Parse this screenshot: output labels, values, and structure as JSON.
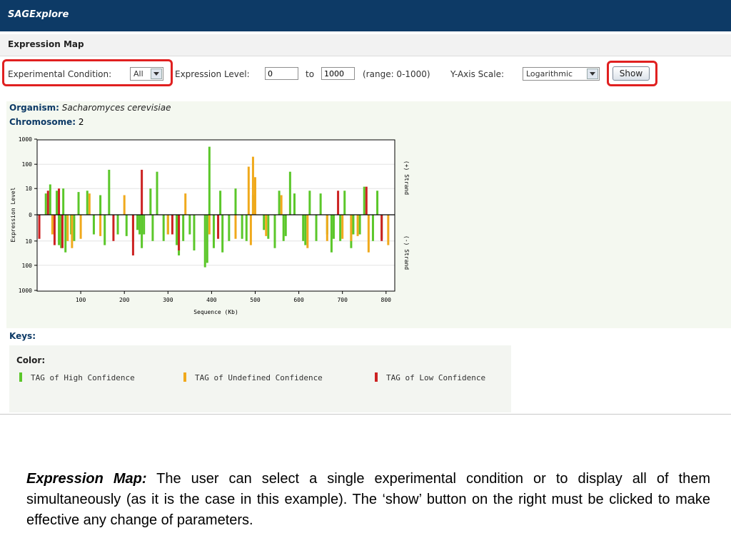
{
  "app": {
    "name": "SAGExplore"
  },
  "page": {
    "title": "Expression Map"
  },
  "controls": {
    "condition_label": "Experimental Condition:",
    "condition_value": "All",
    "level_label": "Expression Level:",
    "level_from": "0",
    "to_label": "to",
    "level_to": "1000",
    "range_hint": "(range: 0-1000)",
    "scale_label": "Y-Axis Scale:",
    "scale_value": "Logarithmic",
    "show_label": "Show"
  },
  "info": {
    "organism_label": "Organism:",
    "organism_value": "Sacharomyces cerevisiae",
    "chromosome_label": "Chromosome:",
    "chromosome_value": "2"
  },
  "keys": {
    "title": "Keys:",
    "color_title": "Color:",
    "items": [
      {
        "label": "TAG of High Confidence",
        "color": "#5bc72a"
      },
      {
        "label": "TAG of Undefined Confidence",
        "color": "#f0a91c"
      },
      {
        "label": "TAG of Low Confidence",
        "color": "#cc2222"
      }
    ]
  },
  "caption": {
    "lead": "Expression Map:",
    "text": "The user can select a single experimental condition or to display all of them simultaneously (as it is the case in this example). The ‘show’ button on the right must be clicked to make effective any change of parameters."
  },
  "chart_data": {
    "type": "bar",
    "xlabel": "Sequence (Kb)",
    "ylabel": "Expression Level",
    "upper_strand_label": "(+) Strand",
    "lower_strand_label": "(-) Strand",
    "x_ticks": [
      100,
      200,
      300,
      400,
      500,
      600,
      700,
      800
    ],
    "xlim": [
      0,
      820
    ],
    "y_ticks": [
      "1000",
      "100",
      "10",
      "0",
      "10",
      "100",
      "1000"
    ],
    "y_scale": "log",
    "ylim": [
      0,
      1000
    ],
    "colors": {
      "high": "#5bc72a",
      "undefined": "#f0a91c",
      "low": "#cc2222"
    },
    "series": [
      {
        "name": "TAG of High Confidence",
        "confidence": "high",
        "x": [
          20,
          30,
          45,
          50,
          55,
          60,
          65,
          78,
          85,
          95,
          115,
          130,
          145,
          155,
          165,
          185,
          205,
          230,
          235,
          240,
          245,
          260,
          265,
          275,
          290,
          300,
          320,
          325,
          335,
          350,
          360,
          385,
          390,
          395,
          405,
          420,
          425,
          440,
          455,
          470,
          480,
          495,
          520,
          530,
          545,
          555,
          565,
          570,
          580,
          590,
          610,
          615,
          625,
          640,
          650,
          665,
          675,
          680,
          695,
          705,
          720,
          725,
          740,
          750,
          770,
          780,
          790
        ],
        "y": [
          6,
          15,
          8,
          -15,
          -20,
          10,
          -30,
          -5,
          -10,
          7,
          8,
          -5,
          5,
          -15,
          60,
          -5,
          -6,
          -3,
          -5,
          -20,
          -5,
          10,
          -10,
          50,
          -10,
          -5,
          -15,
          -40,
          -10,
          -5,
          -25,
          -120,
          -80,
          500,
          -20,
          8,
          -30,
          -10,
          10,
          -8,
          -10,
          5,
          -3,
          -8,
          -20,
          8,
          -10,
          -6,
          50,
          6,
          -10,
          -15,
          8,
          -10,
          6,
          -5,
          -30,
          -8,
          -10,
          8,
          -20,
          -5,
          -5,
          12,
          -10,
          8,
          -8
        ]
      },
      {
        "name": "TAG of Undefined Confidence",
        "confidence": "undefined",
        "x": [
          35,
          70,
          80,
          100,
          120,
          145,
          200,
          220,
          300,
          340,
          395,
          455,
          485,
          490,
          495,
          500,
          525,
          560,
          620,
          665,
          700,
          720,
          735,
          760,
          805
        ],
        "y": [
          -5,
          -10,
          -20,
          -8,
          6,
          -6,
          5,
          -10,
          -5,
          6,
          -5,
          -8,
          80,
          -15,
          200,
          30,
          -6,
          5,
          -20,
          -10,
          -8,
          -10,
          -6,
          -30,
          -15
        ]
      },
      {
        "name": "TAG of Low Confidence",
        "confidence": "low",
        "x": [
          5,
          25,
          40,
          50,
          58,
          175,
          220,
          240,
          310,
          325,
          415,
          690,
          755,
          790
        ],
        "y": [
          -8,
          8,
          -15,
          10,
          -20,
          -10,
          -40,
          60,
          -5,
          -25,
          -8,
          8,
          12,
          -10
        ]
      }
    ]
  }
}
